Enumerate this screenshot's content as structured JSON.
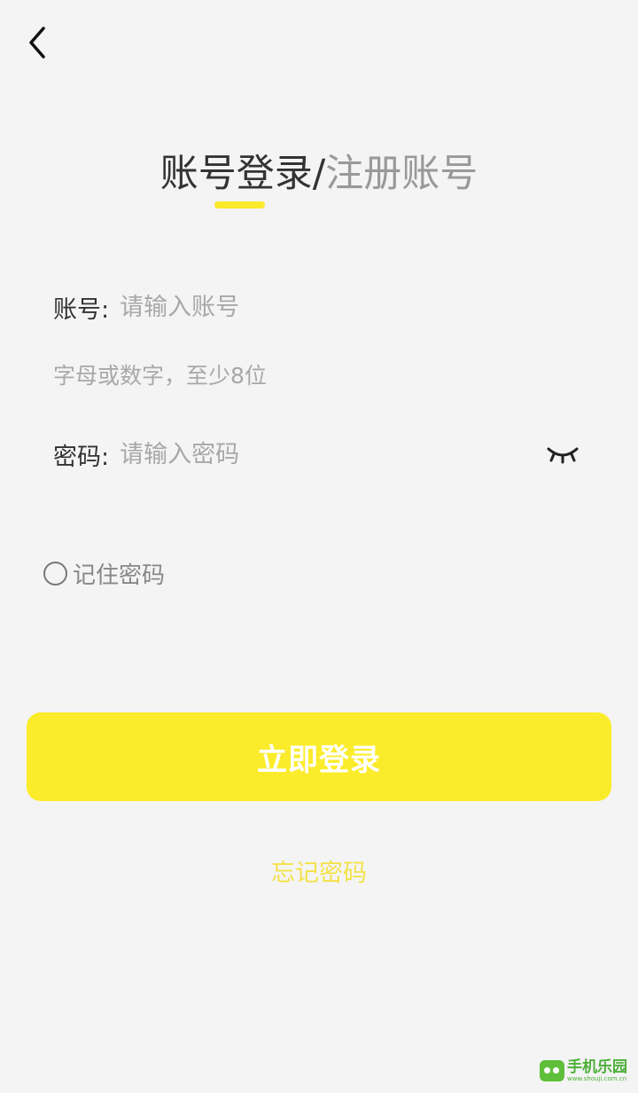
{
  "header": {
    "back_icon": "chevron-left-icon"
  },
  "tabs": {
    "login_label": "账号登录",
    "separator": "/",
    "register_label": "注册账号",
    "active_color": "#fbe92b"
  },
  "account": {
    "label": "账号:",
    "placeholder": "请输入账号",
    "value": "",
    "hint": "字母或数字，至少8位"
  },
  "password": {
    "label": "密码:",
    "placeholder": "请输入密码",
    "value": "",
    "visibility_icon": "eye-closed-icon"
  },
  "remember": {
    "label": "记住密码",
    "checked": false
  },
  "actions": {
    "login_label": "立即登录",
    "login_color": "#fbec2b",
    "forgot_label": "忘记密码"
  },
  "watermark": {
    "text": "手机乐园",
    "url": "www.shouji.com.cn"
  }
}
